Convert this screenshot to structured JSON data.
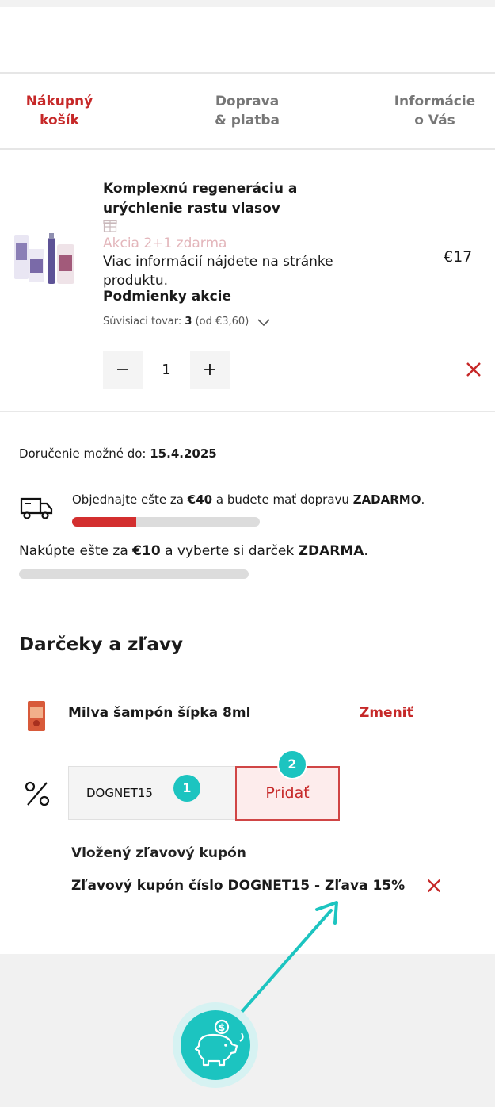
{
  "steps": [
    {
      "line1": "Nákupný",
      "line2": "košík"
    },
    {
      "line1": "Doprava",
      "line2": "& platba"
    },
    {
      "line1": "Informácie",
      "line2": "o Vás"
    }
  ],
  "cart": {
    "product_name": "Komplexnú regeneráciu a urýchlenie rastu vlasov",
    "promo": "Akcia 2+1 zdarma",
    "promo_info": "Viac informácií nájdete na stránke produktu.",
    "promo_conditions": "Podmienky akcie",
    "related_label": "Súvisiaci tovar:",
    "related_count": "3",
    "related_price": "(od €3,60)",
    "price": "€17",
    "quantity": "1",
    "minus": "−",
    "plus": "+"
  },
  "delivery": {
    "label": "Doručenie možné do:",
    "date": "15.4.2025"
  },
  "shipping": {
    "text_pre": "Objednajte ešte za",
    "amount": "€40",
    "text_mid": "a budete mať dopravu",
    "free": "ZADARMO",
    "end": ".",
    "progress": 0.34
  },
  "gift_progress": {
    "text_pre": "Nakúpte ešte za",
    "amount": "€10",
    "text_mid": "a vyberte si darček",
    "free": "ZDARMA",
    "end": ".",
    "progress": 0.0
  },
  "gifts": {
    "heading": "Darčeky a zľavy",
    "item": "Milva šampón šípka 8ml",
    "change": "Zmeniť"
  },
  "coupon": {
    "value": "DOGNET15",
    "add_label": "Pridať",
    "badge1": "1",
    "badge2": "2",
    "applied_heading": "Vložený zľavový kupón",
    "applied_text": "Zľavový kupón číslo DOGNET15 - Zľava 15%"
  },
  "colors": {
    "accent": "#c62828",
    "teal": "#1cc4c0"
  },
  "icons": [
    "gift-icon",
    "chevron-down-icon",
    "remove-icon",
    "truck-icon",
    "percent-icon",
    "piggy-bank-icon"
  ]
}
